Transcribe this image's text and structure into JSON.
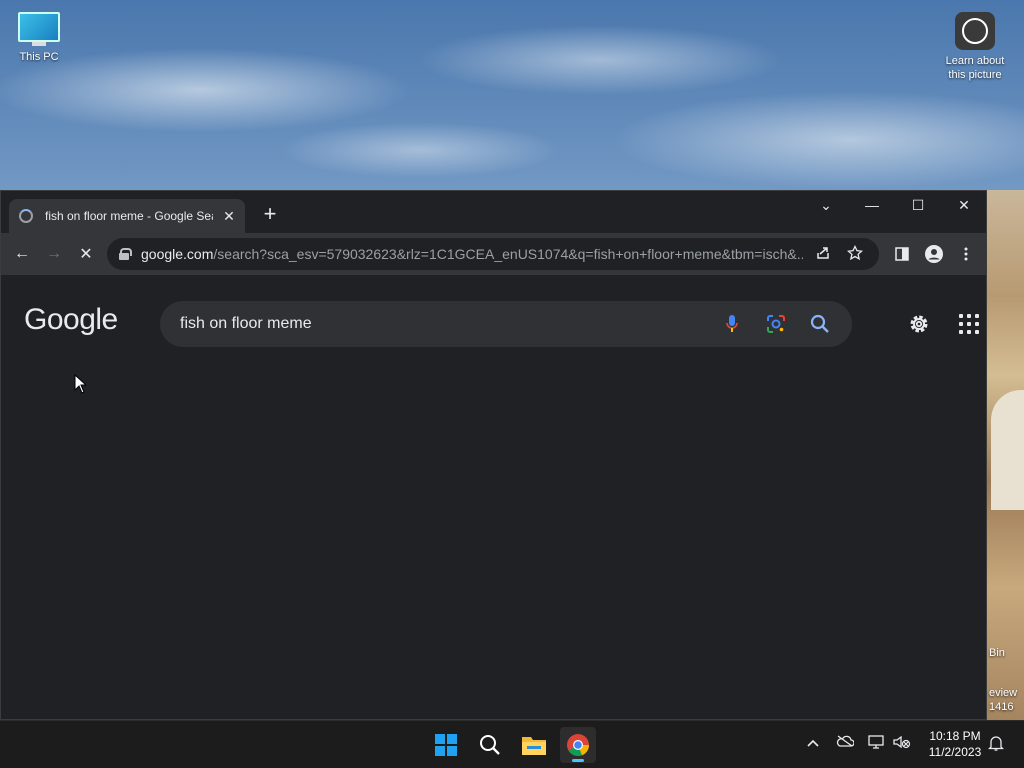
{
  "desktop": {
    "this_pc_label": "This PC",
    "learn_label_line1": "Learn about",
    "learn_label_line2": "this picture",
    "right_edge_text_1": "Bin",
    "right_edge_text_2": "eview",
    "right_edge_text_3": "1416"
  },
  "browser": {
    "tab": {
      "title": "fish on floor meme - Google Sea",
      "close_glyph": "✕"
    },
    "new_tab_glyph": "+",
    "window_controls": {
      "dropdown": "⌄",
      "minimize": "—",
      "maximize": "☐",
      "close": "✕"
    },
    "toolbar": {
      "back_glyph": "←",
      "forward_glyph": "→",
      "stop_glyph": "✕",
      "url_host": "google.com",
      "url_rest": "/search?sca_esv=579032623&rlz=1C1GCEA_enUS1074&q=fish+on+floor+meme&tbm=isch&..."
    }
  },
  "page": {
    "logo_text": "Google",
    "logo_colors": [
      "#e8eaed",
      "#e8eaed",
      "#e8eaed",
      "#e8eaed",
      "#e8eaed",
      "#e8eaed"
    ],
    "search_query": "fish on floor meme"
  },
  "taskbar": {
    "time": "10:18 PM",
    "date": "11/2/2023",
    "accent_color": "#4cc2ff"
  },
  "icons": [
    "this-pc-icon",
    "learn-about-picture-icon",
    "favicon-icon",
    "back-icon",
    "forward-icon",
    "stop-icon",
    "lock-icon",
    "share-icon",
    "star-icon",
    "side-panel-icon",
    "profile-icon",
    "menu-icon",
    "mic-icon",
    "lens-icon",
    "search-icon",
    "settings-icon",
    "apps-icon",
    "windows-start-icon",
    "taskbar-search-icon",
    "file-explorer-icon",
    "chrome-icon",
    "chevron-up-icon",
    "onedrive-icon",
    "network-icon",
    "volume-muted-icon",
    "notification-bell-icon"
  ]
}
